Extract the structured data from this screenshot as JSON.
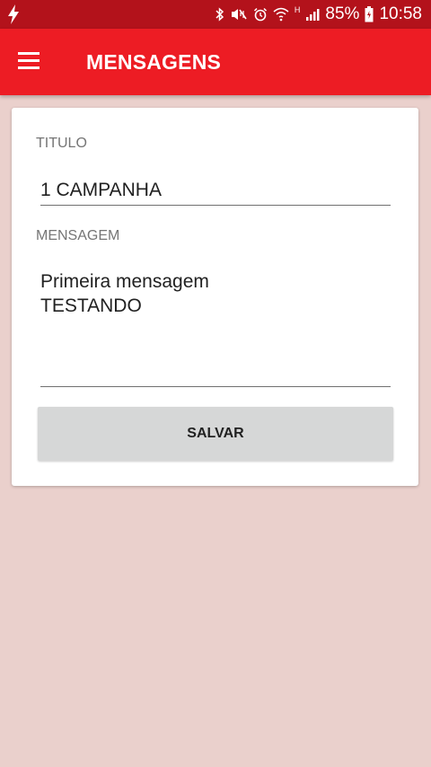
{
  "status_bar": {
    "battery": "85%",
    "time": "10:58",
    "network_type": "H",
    "icons": [
      "flash-icon",
      "bluetooth-icon",
      "mute-icon",
      "alarm-icon",
      "wifi-icon",
      "signal-icon",
      "battery-icon"
    ]
  },
  "app_bar": {
    "title": "MENSAGENS",
    "menu_icon": "menu-icon"
  },
  "form": {
    "title_label": "TITULO",
    "title_value": "1 CAMPANHA",
    "message_label": "MENSAGEM",
    "message_lines": [
      "Primeira mensagem",
      "TESTANDO"
    ],
    "save_label": "SALVAR"
  },
  "colors": {
    "status_bar": "#b3121b",
    "app_bar": "#ed1c24",
    "background": "#ead0cc",
    "button": "#d6d7d7"
  }
}
